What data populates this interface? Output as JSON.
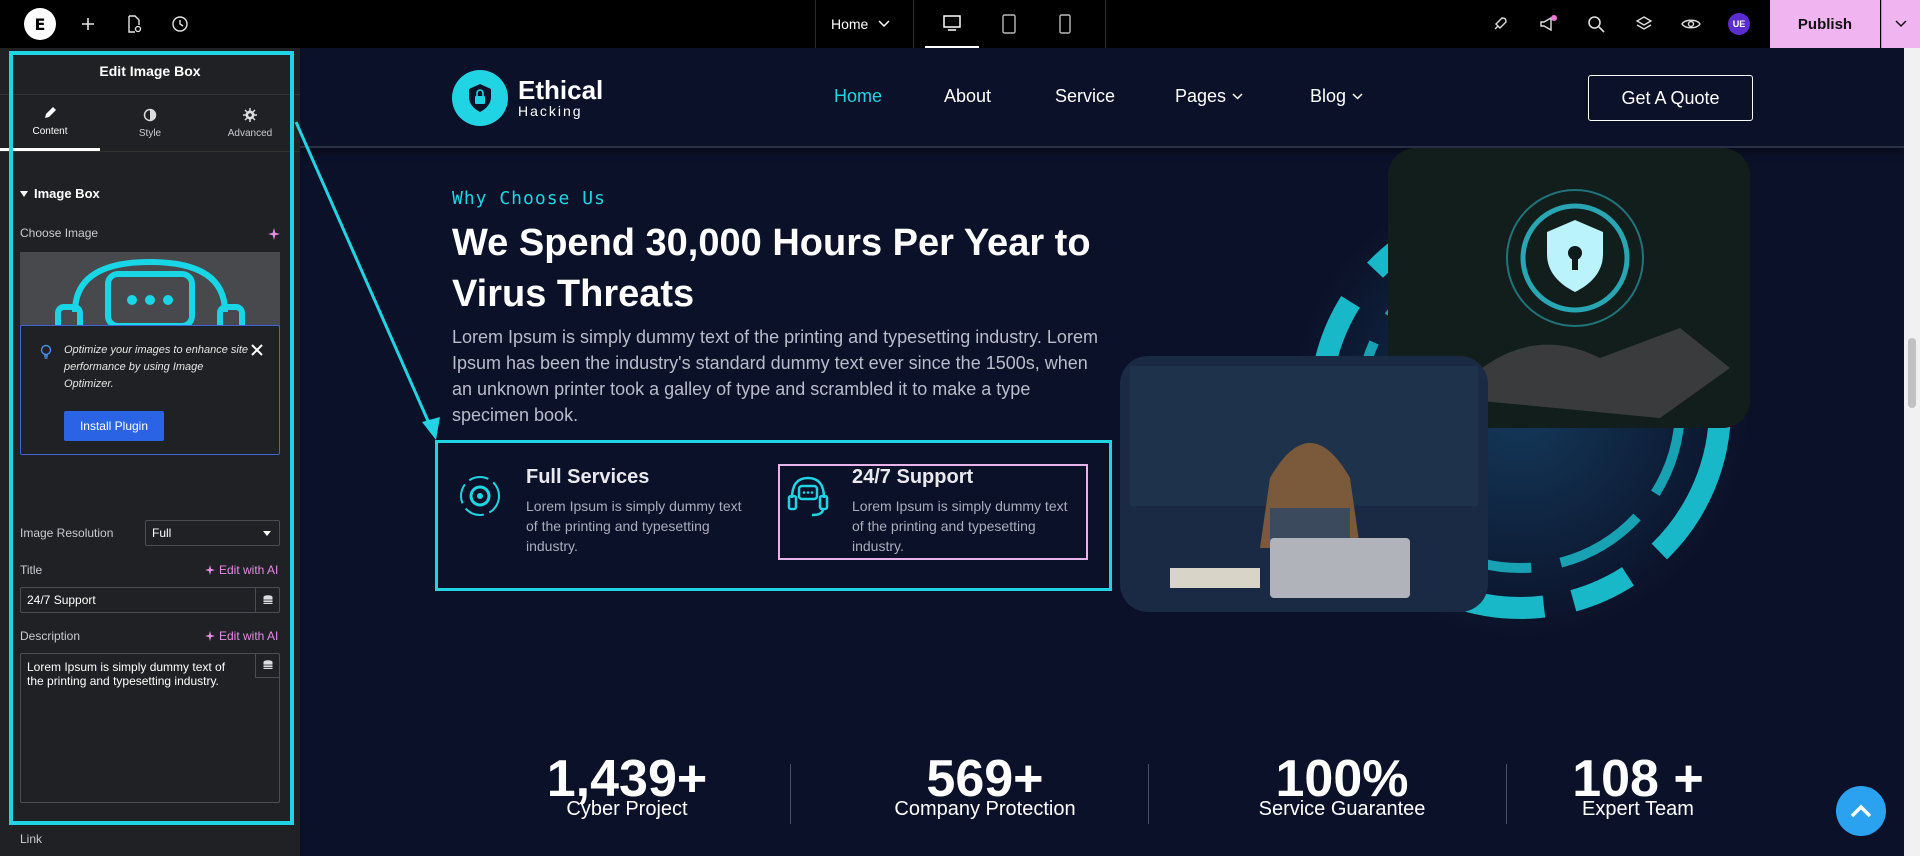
{
  "topbar": {
    "page_name": "Home",
    "publish_label": "Publish",
    "avatar_initials": "UE"
  },
  "panel": {
    "title": "Edit Image Box",
    "tabs": [
      {
        "label": "Content",
        "icon": "pencil-icon"
      },
      {
        "label": "Style",
        "icon": "half-circle-icon"
      },
      {
        "label": "Advanced",
        "icon": "gear-icon"
      }
    ],
    "section_title": "Image Box",
    "choose_image_label": "Choose Image",
    "notice_text": "Optimize your images to enhance site performance by using Image Optimizer.",
    "install_plugin_label": "Install Plugin",
    "image_resolution_label": "Image Resolution",
    "image_resolution_value": "Full",
    "title_label": "Title",
    "title_value": "24/7 Support",
    "edit_ai_label": "Edit with AI",
    "description_label": "Description",
    "description_value": "Lorem Ipsum is simply dummy text of the printing and typesetting industry.",
    "link_label": "Link"
  },
  "site": {
    "brand_name": "Ethical",
    "brand_sub": "Hacking",
    "nav": [
      "Home",
      "About",
      "Service",
      "Pages",
      "Blog"
    ],
    "quote_label": "Get A Quote",
    "eyebrow": "Why Choose Us",
    "heading": "We Spend 30,000 Hours Per Year to Virus Threats",
    "body": "Lorem Ipsum is simply dummy text of the printing and typesetting industry. Lorem Ipsum has been the industry's standard dummy text ever since the 1500s, when an unknown printer took a galley of type and scrambled it to make a type specimen book.",
    "features": [
      {
        "title": "Full Services",
        "desc": "Lorem Ipsum is simply dummy text of the printing and typesetting industry."
      },
      {
        "title": "24/7 Support",
        "desc": "Lorem Ipsum is simply dummy text of the printing and typesetting industry."
      }
    ],
    "stats": [
      {
        "num": "1,439+",
        "label": "Cyber Project"
      },
      {
        "num": "569+",
        "label": "Company Protection"
      },
      {
        "num": "100%",
        "label": "Service Guarantee"
      },
      {
        "num": "108 +",
        "label": "Expert Team"
      }
    ]
  },
  "colors": {
    "accent": "#21d4e3",
    "publish": "#f0b4f0",
    "panel_bg": "#1f2124",
    "canvas_bg": "#0b1128"
  }
}
